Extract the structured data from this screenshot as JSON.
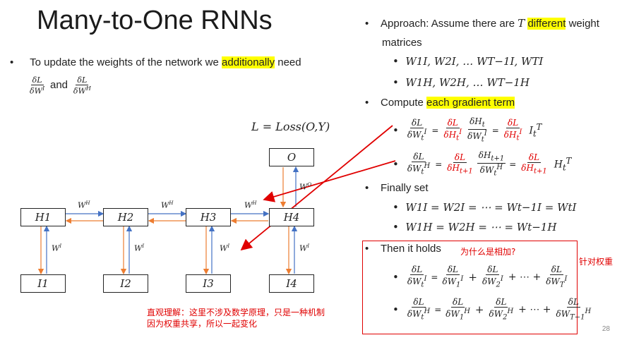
{
  "title": "Many-to-One RNNs",
  "left": {
    "bullet_prefix": "To update the weights of the network we ",
    "bullet_highlight": "additionally",
    "bullet_suffix": " need",
    "frac1_num": "δL",
    "frac1_den": "δW",
    "frac1_den_sup": "I",
    "and_text": "and",
    "frac2_num": "δL",
    "frac2_den": "δW",
    "frac2_den_sup": "H",
    "loss_eq": "L = Loss(O,Y)"
  },
  "diagram": {
    "hidden_nodes": [
      "H1",
      "H2",
      "H3",
      "H4"
    ],
    "input_nodes": [
      "I1",
      "I2",
      "I3",
      "I4"
    ],
    "output_node": "O",
    "wh_label": "W",
    "wh_sup": "H",
    "wi_label": "W",
    "wi_sup": "I",
    "wo_label": "W",
    "wo_sup": "O"
  },
  "right": {
    "approach_prefix": "Approach: Assume there are ",
    "approach_T": "T",
    "approach_highlight": "different",
    "approach_suffix": " weight",
    "approach_line2": "matrices",
    "wi_list": "W1I, W2I, … WT−1I, WTI",
    "wh_list": "W1H, W2H, … WT−1H",
    "compute_prefix": "Compute ",
    "compute_highlight": "each gradient term",
    "finally_set": "Finally set",
    "eq_wi": "W1I = W2I = ⋯ = Wt−1I = WtI",
    "eq_wh": "W1H = W2H = ⋯ = Wt−1H",
    "then_it_holds": "Then it holds"
  },
  "annotations": {
    "why_sum": "为什么是相加?",
    "for_weights": "针对权重",
    "intuition_line1": "直观理解：这里不涉及数学原理，只是一种机制",
    "intuition_line2": "因为权重共享，所以一起变化"
  },
  "page_number": "28",
  "colors": {
    "highlight": "#ffff00",
    "annotation_red": "#e00000",
    "forward_arrow": "#4472c4",
    "backward_arrow": "#ed7d31"
  }
}
